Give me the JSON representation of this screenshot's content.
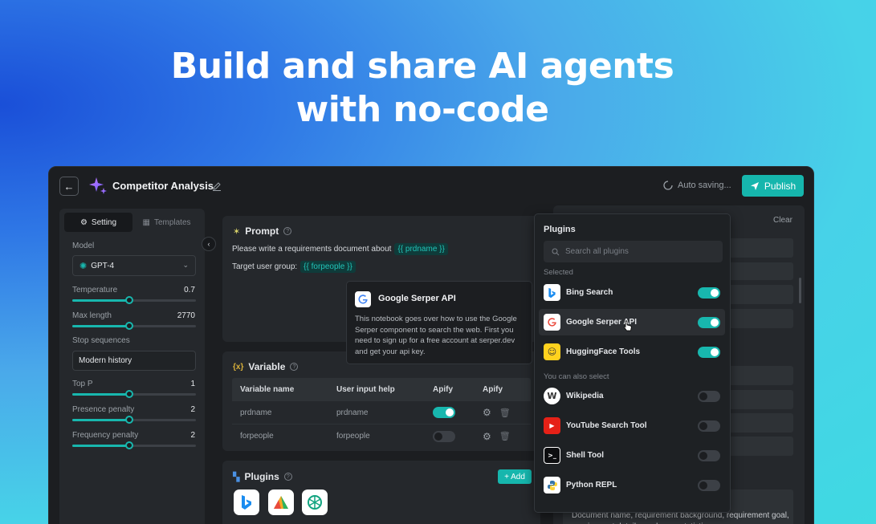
{
  "hero": {
    "line1": "Build and share AI agents",
    "line2": "with no-code"
  },
  "topbar": {
    "title": "Competitor Analysis",
    "autosave": "Auto saving...",
    "publish_label": "Publish"
  },
  "left": {
    "tabs": [
      "Setting",
      "Templates"
    ],
    "model_label": "Model",
    "model_value": "GPT-4",
    "params": [
      {
        "label": "Temperature",
        "value": "0.7",
        "level": 0.46
      },
      {
        "label": "Max length",
        "value": "2770",
        "level": 0.46
      }
    ],
    "stop_label": "Stop sequences",
    "stop_value": "Modern history",
    "params2": [
      {
        "label": "Top P",
        "value": "1",
        "level": 0.46
      },
      {
        "label": "Presence penalty",
        "value": "2",
        "level": 0.46
      },
      {
        "label": "Frequency penalty",
        "value": "2",
        "level": 0.46
      }
    ]
  },
  "prompt": {
    "title": "Prompt",
    "line1_text": "Please write a requirements document about",
    "line1_var": "{{ prdname }}",
    "line2_text": "Target user group:",
    "line2_var": "{{ forpeople }}"
  },
  "tooltip": {
    "title": "Google Serper API",
    "body": "This notebook goes over how to use the Google Serper component to search the web. First you need to sign up for a free account at serper.dev and get your api key."
  },
  "variable": {
    "title": "Variable",
    "headers": [
      "Variable name",
      "User input help",
      "Apify",
      "Apify"
    ],
    "rows": [
      {
        "name": "prdname",
        "help": "prdname",
        "on": true
      },
      {
        "name": "forpeople",
        "help": "forpeople",
        "on": false
      }
    ]
  },
  "plugins_card": {
    "title": "Plugins",
    "add_label": "+ Add"
  },
  "right": {
    "clear_label": "Clear",
    "text": "Document name, requirement background, requirement goal, requirement details, and page statistics"
  },
  "plugins_popup": {
    "title": "Plugins",
    "search_placeholder": "Search all plugins",
    "selected_label": "Selected",
    "selected": [
      {
        "name": "Bing Search",
        "on": true,
        "icon": "bing-icon"
      },
      {
        "name": "Google Serper API",
        "on": true,
        "icon": "google-icon"
      },
      {
        "name": "HuggingFace Tools",
        "on": true,
        "icon": "huggingface-icon"
      }
    ],
    "also_label": "You can also select",
    "others": [
      {
        "name": "Wikipedia",
        "on": false,
        "icon": "wikipedia-icon"
      },
      {
        "name": "YouTube Search Tool",
        "on": false,
        "icon": "youtube-icon"
      },
      {
        "name": "Shell Tool",
        "on": false,
        "icon": "terminal-icon"
      },
      {
        "name": "Python REPL",
        "on": false,
        "icon": "python-icon"
      }
    ]
  },
  "colors": {
    "accent": "#16b6ad",
    "panel": "#25282c",
    "app_bg": "#1c1e21"
  }
}
